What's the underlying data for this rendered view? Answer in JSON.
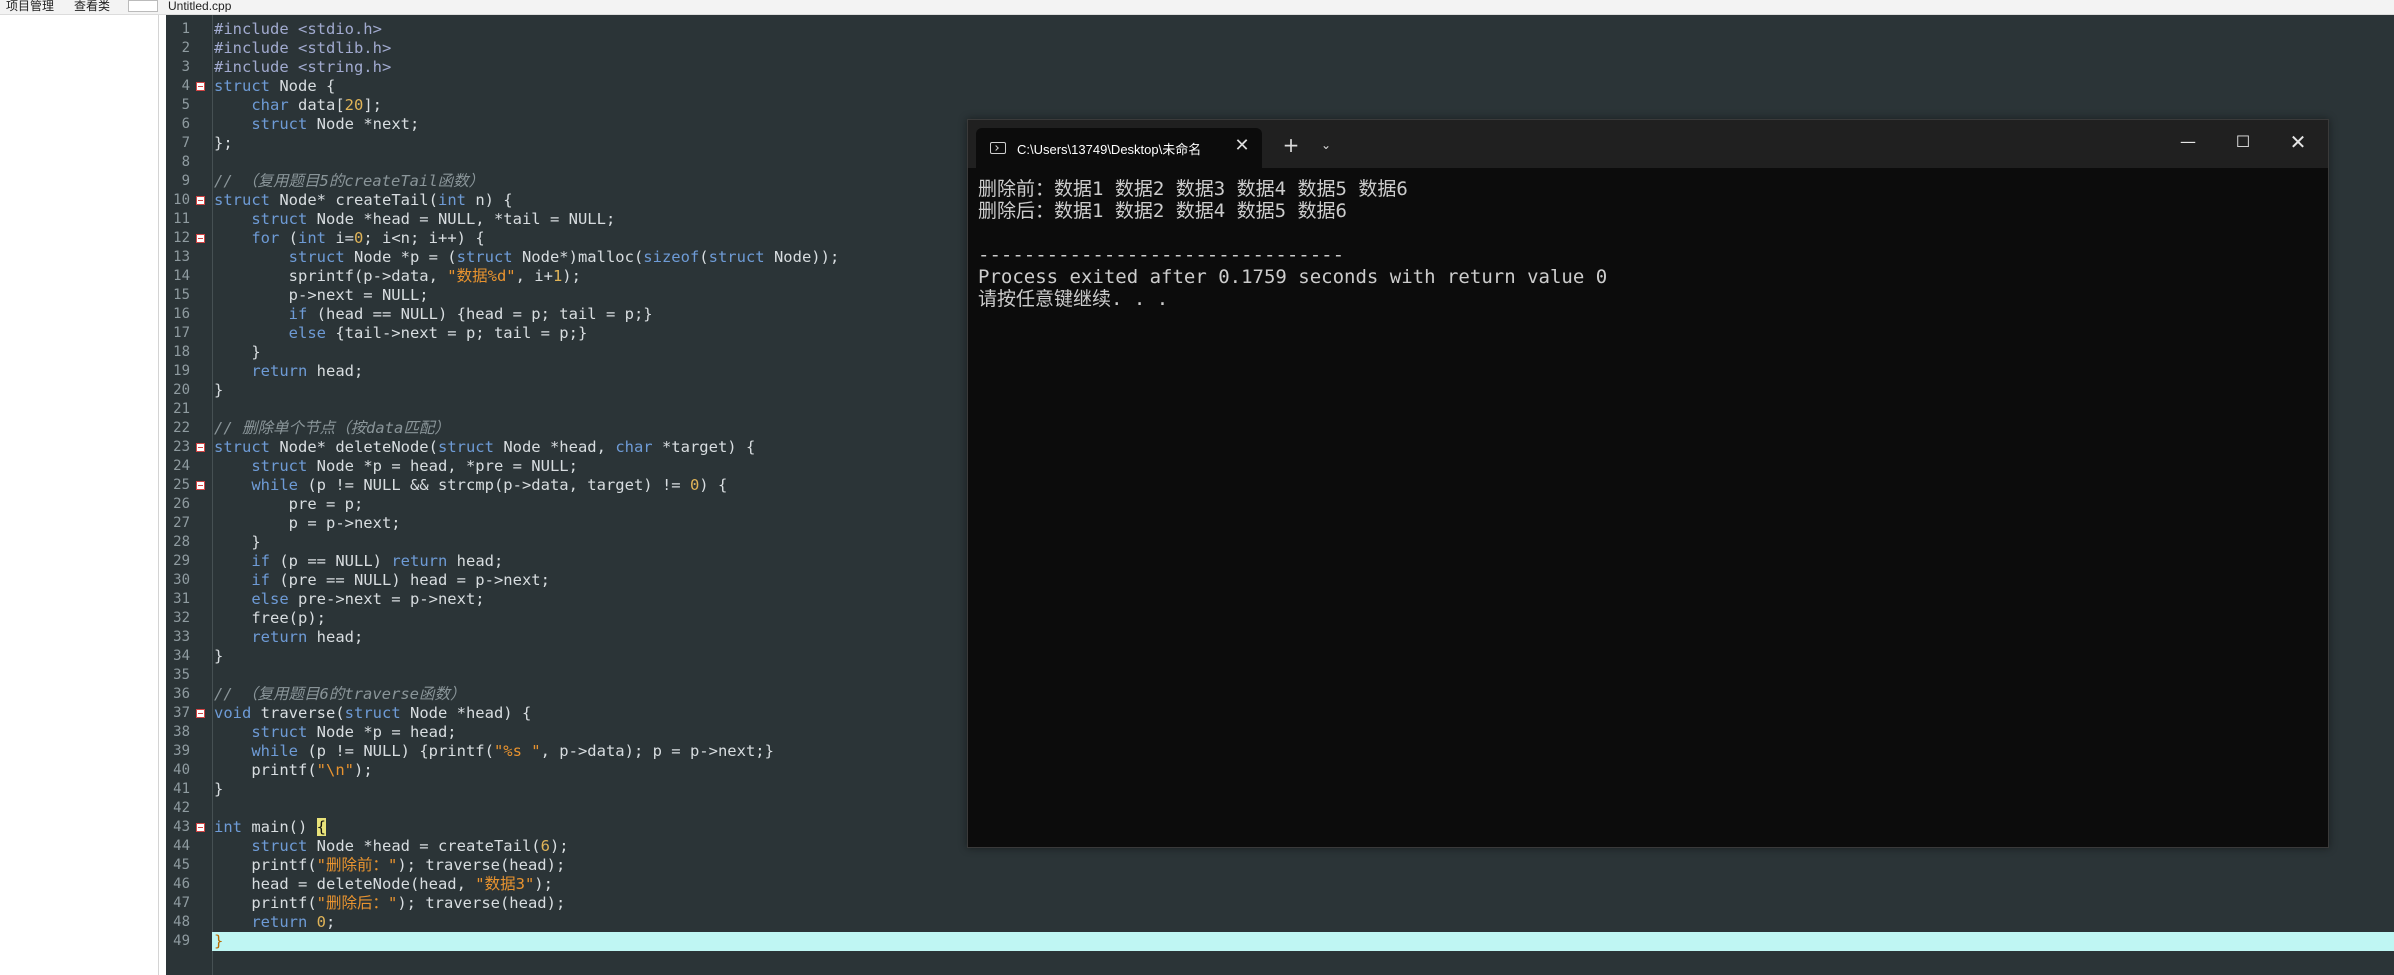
{
  "window": {
    "top_fragments": [
      "项目管理",
      "查看类",
      "Untitled.cpp"
    ]
  },
  "editor": {
    "lines": [
      "#include <stdio.h>",
      "#include <stdlib.h>",
      "#include <string.h>",
      "struct Node {",
      "    char data[20];",
      "    struct Node *next;",
      "};",
      "",
      "// （复用题目5的createTail函数）",
      "struct Node* createTail(int n) {",
      "    struct Node *head = NULL, *tail = NULL;",
      "    for (int i=0; i<n; i++) {",
      "        struct Node *p = (struct Node*)malloc(sizeof(struct Node));",
      "        sprintf(p->data, \"数据%d\", i+1);",
      "        p->next = NULL;",
      "        if (head == NULL) {head = p; tail = p;}",
      "        else {tail->next = p; tail = p;}",
      "    }",
      "    return head;",
      "}",
      "",
      "// 删除单个节点（按data匹配）",
      "struct Node* deleteNode(struct Node *head, char *target) {",
      "    struct Node *p = head, *pre = NULL;",
      "    while (p != NULL && strcmp(p->data, target) != 0) {",
      "        pre = p;",
      "        p = p->next;",
      "    }",
      "    if (p == NULL) return head;",
      "    if (pre == NULL) head = p->next;",
      "    else pre->next = p->next;",
      "    free(p);",
      "    return head;",
      "}",
      "",
      "// （复用题目6的traverse函数）",
      "void traverse(struct Node *head) {",
      "    struct Node *p = head;",
      "    while (p != NULL) {printf(\"%s \", p->data); p = p->next;}",
      "    printf(\"\\n\");",
      "}",
      "",
      "int main() {",
      "    struct Node *head = createTail(6);",
      "    printf(\"删除前：\"); traverse(head);",
      "    head = deleteNode(head, \"数据3\");",
      "    printf(\"删除后：\"); traverse(head);",
      "    return 0;",
      "}"
    ],
    "fold_lines": [
      4,
      10,
      12,
      23,
      25,
      37,
      43
    ],
    "current_line": 49
  },
  "terminal": {
    "tab_title": "C:\\Users\\13749\\Desktop\\未命名",
    "close_tab_glyph": "✕",
    "new_tab_glyph": "+",
    "dropdown_glyph": "⌄",
    "minimize_glyph": "—",
    "maximize_glyph": "☐",
    "close_glyph": "✕",
    "output": [
      "删除前：数据1 数据2 数据3 数据4 数据5 数据6",
      "删除后：数据1 数据2 数据4 数据5 数据6",
      "",
      "--------------------------------",
      "Process exited after 0.1759 seconds with return value 0",
      "请按任意键继续. . ."
    ]
  },
  "colors": {
    "editor_bg": "#2b3437",
    "keyword": "#6e9bd6",
    "number": "#e0b458",
    "string": "#e8932f",
    "comment": "#8a9599",
    "current_line": "#bff6f3",
    "terminal_bg": "#0c0c0c"
  }
}
